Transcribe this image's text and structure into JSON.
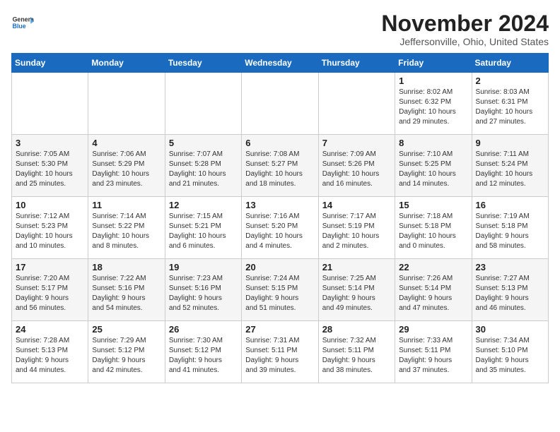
{
  "header": {
    "logo_line1": "General",
    "logo_line2": "Blue",
    "month_title": "November 2024",
    "location": "Jeffersonville, Ohio, United States"
  },
  "weekdays": [
    "Sunday",
    "Monday",
    "Tuesday",
    "Wednesday",
    "Thursday",
    "Friday",
    "Saturday"
  ],
  "weeks": [
    [
      {
        "day": "",
        "info": ""
      },
      {
        "day": "",
        "info": ""
      },
      {
        "day": "",
        "info": ""
      },
      {
        "day": "",
        "info": ""
      },
      {
        "day": "",
        "info": ""
      },
      {
        "day": "1",
        "info": "Sunrise: 8:02 AM\nSunset: 6:32 PM\nDaylight: 10 hours\nand 29 minutes."
      },
      {
        "day": "2",
        "info": "Sunrise: 8:03 AM\nSunset: 6:31 PM\nDaylight: 10 hours\nand 27 minutes."
      }
    ],
    [
      {
        "day": "3",
        "info": "Sunrise: 7:05 AM\nSunset: 5:30 PM\nDaylight: 10 hours\nand 25 minutes."
      },
      {
        "day": "4",
        "info": "Sunrise: 7:06 AM\nSunset: 5:29 PM\nDaylight: 10 hours\nand 23 minutes."
      },
      {
        "day": "5",
        "info": "Sunrise: 7:07 AM\nSunset: 5:28 PM\nDaylight: 10 hours\nand 21 minutes."
      },
      {
        "day": "6",
        "info": "Sunrise: 7:08 AM\nSunset: 5:27 PM\nDaylight: 10 hours\nand 18 minutes."
      },
      {
        "day": "7",
        "info": "Sunrise: 7:09 AM\nSunset: 5:26 PM\nDaylight: 10 hours\nand 16 minutes."
      },
      {
        "day": "8",
        "info": "Sunrise: 7:10 AM\nSunset: 5:25 PM\nDaylight: 10 hours\nand 14 minutes."
      },
      {
        "day": "9",
        "info": "Sunrise: 7:11 AM\nSunset: 5:24 PM\nDaylight: 10 hours\nand 12 minutes."
      }
    ],
    [
      {
        "day": "10",
        "info": "Sunrise: 7:12 AM\nSunset: 5:23 PM\nDaylight: 10 hours\nand 10 minutes."
      },
      {
        "day": "11",
        "info": "Sunrise: 7:14 AM\nSunset: 5:22 PM\nDaylight: 10 hours\nand 8 minutes."
      },
      {
        "day": "12",
        "info": "Sunrise: 7:15 AM\nSunset: 5:21 PM\nDaylight: 10 hours\nand 6 minutes."
      },
      {
        "day": "13",
        "info": "Sunrise: 7:16 AM\nSunset: 5:20 PM\nDaylight: 10 hours\nand 4 minutes."
      },
      {
        "day": "14",
        "info": "Sunrise: 7:17 AM\nSunset: 5:19 PM\nDaylight: 10 hours\nand 2 minutes."
      },
      {
        "day": "15",
        "info": "Sunrise: 7:18 AM\nSunset: 5:18 PM\nDaylight: 10 hours\nand 0 minutes."
      },
      {
        "day": "16",
        "info": "Sunrise: 7:19 AM\nSunset: 5:18 PM\nDaylight: 9 hours\nand 58 minutes."
      }
    ],
    [
      {
        "day": "17",
        "info": "Sunrise: 7:20 AM\nSunset: 5:17 PM\nDaylight: 9 hours\nand 56 minutes."
      },
      {
        "day": "18",
        "info": "Sunrise: 7:22 AM\nSunset: 5:16 PM\nDaylight: 9 hours\nand 54 minutes."
      },
      {
        "day": "19",
        "info": "Sunrise: 7:23 AM\nSunset: 5:16 PM\nDaylight: 9 hours\nand 52 minutes."
      },
      {
        "day": "20",
        "info": "Sunrise: 7:24 AM\nSunset: 5:15 PM\nDaylight: 9 hours\nand 51 minutes."
      },
      {
        "day": "21",
        "info": "Sunrise: 7:25 AM\nSunset: 5:14 PM\nDaylight: 9 hours\nand 49 minutes."
      },
      {
        "day": "22",
        "info": "Sunrise: 7:26 AM\nSunset: 5:14 PM\nDaylight: 9 hours\nand 47 minutes."
      },
      {
        "day": "23",
        "info": "Sunrise: 7:27 AM\nSunset: 5:13 PM\nDaylight: 9 hours\nand 46 minutes."
      }
    ],
    [
      {
        "day": "24",
        "info": "Sunrise: 7:28 AM\nSunset: 5:13 PM\nDaylight: 9 hours\nand 44 minutes."
      },
      {
        "day": "25",
        "info": "Sunrise: 7:29 AM\nSunset: 5:12 PM\nDaylight: 9 hours\nand 42 minutes."
      },
      {
        "day": "26",
        "info": "Sunrise: 7:30 AM\nSunset: 5:12 PM\nDaylight: 9 hours\nand 41 minutes."
      },
      {
        "day": "27",
        "info": "Sunrise: 7:31 AM\nSunset: 5:11 PM\nDaylight: 9 hours\nand 39 minutes."
      },
      {
        "day": "28",
        "info": "Sunrise: 7:32 AM\nSunset: 5:11 PM\nDaylight: 9 hours\nand 38 minutes."
      },
      {
        "day": "29",
        "info": "Sunrise: 7:33 AM\nSunset: 5:11 PM\nDaylight: 9 hours\nand 37 minutes."
      },
      {
        "day": "30",
        "info": "Sunrise: 7:34 AM\nSunset: 5:10 PM\nDaylight: 9 hours\nand 35 minutes."
      }
    ]
  ]
}
